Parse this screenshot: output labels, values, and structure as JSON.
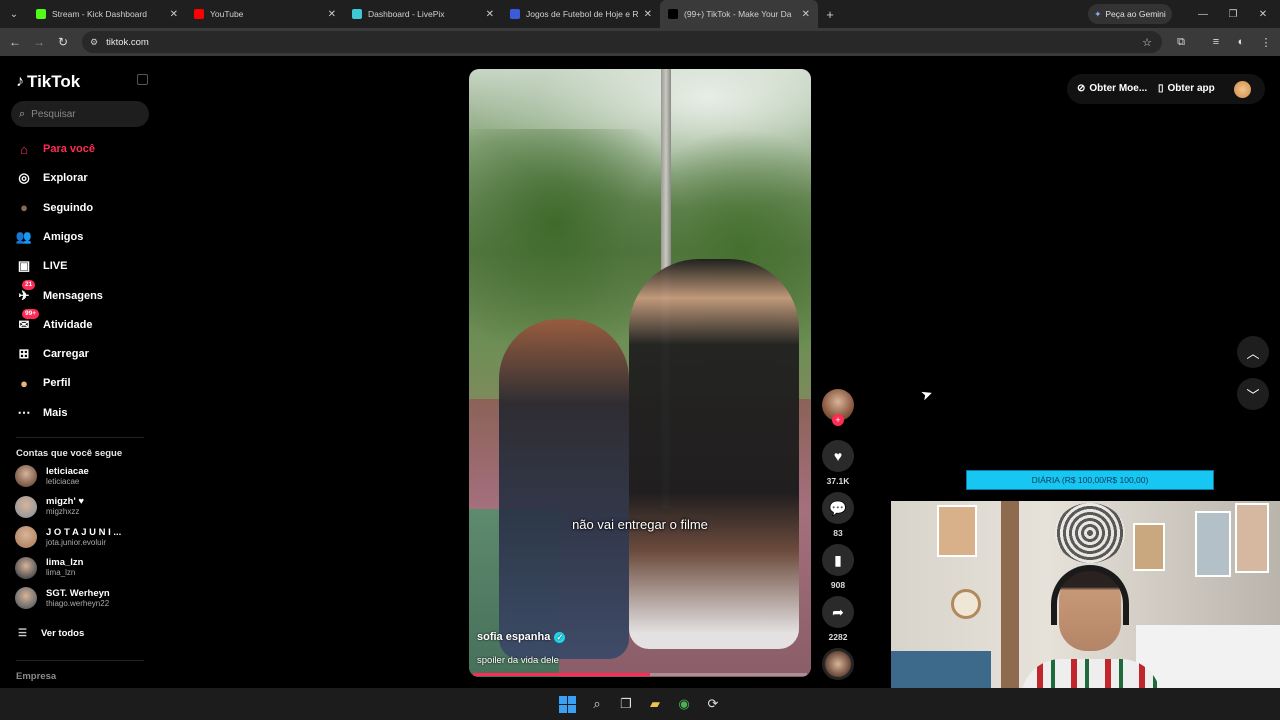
{
  "browser": {
    "tabs": [
      {
        "title": "Stream - Kick Dashboard",
        "favicon": "kick-icon",
        "color": "#53fc18",
        "active": false
      },
      {
        "title": "YouTube",
        "favicon": "youtube-icon",
        "color": "#ff0000",
        "active": false
      },
      {
        "title": "Dashboard - LivePix",
        "favicon": "livepix-icon",
        "color": "#3ec9d6",
        "active": false
      },
      {
        "title": "Jogos de Futebol de Hoje e Res",
        "favicon": "ge-icon",
        "color": "#3b5bdb",
        "active": false
      },
      {
        "title": "(99+) TikTok - Make Your Da",
        "favicon": "tiktok-icon",
        "color": "#000000",
        "active": true
      }
    ],
    "gemini_label": "Peça ao Gemini",
    "url": "tiktok.com"
  },
  "tiktok": {
    "logo": "TikTok",
    "search_placeholder": "Pesquisar",
    "nav": [
      {
        "label": "Para você",
        "icon": "home-icon",
        "active": true,
        "badge": ""
      },
      {
        "label": "Explorar",
        "icon": "compass-icon",
        "active": false,
        "badge": ""
      },
      {
        "label": "Seguindo",
        "icon": "following-avatar-icon",
        "active": false,
        "badge": ""
      },
      {
        "label": "Amigos",
        "icon": "friends-icon",
        "active": false,
        "badge": ""
      },
      {
        "label": "LIVE",
        "icon": "live-icon",
        "active": false,
        "badge": ""
      },
      {
        "label": "Mensagens",
        "icon": "messages-icon",
        "active": false,
        "badge": "21"
      },
      {
        "label": "Atividade",
        "icon": "activity-icon",
        "active": false,
        "badge": "99+"
      },
      {
        "label": "Carregar",
        "icon": "upload-icon",
        "active": false,
        "badge": ""
      },
      {
        "label": "Perfil",
        "icon": "profile-avatar-icon",
        "active": false,
        "badge": ""
      },
      {
        "label": "Mais",
        "icon": "more-icon",
        "active": false,
        "badge": ""
      }
    ],
    "following_heading": "Contas que você segue",
    "following": [
      {
        "name": "leticiacae",
        "username": "leticiacae"
      },
      {
        "name": "migzh' ♥",
        "username": "migzhxzz"
      },
      {
        "name": "J O T A  J U N I ...",
        "username": "jota.junior.evoluir"
      },
      {
        "name": "lima_lzn",
        "username": "lima_lzn"
      },
      {
        "name": "SGT. Werheyn",
        "username": "thiago.werheyn22"
      }
    ],
    "see_all": "Ver todos",
    "company": "Empresa",
    "top_right": {
      "coins": "Obter Moe...",
      "app": "Obter app"
    },
    "video": {
      "caption": "não vai entregar o filme",
      "author": "sofia espanha",
      "description": "spoiler da vida dele",
      "progress": 0.53
    },
    "actions": {
      "likes": "37.1K",
      "comments": "83",
      "saves": "908",
      "shares": "2282"
    }
  },
  "overlay": {
    "goal_label": "DIÁRIA (R$ 100,00/R$ 100,00)"
  }
}
